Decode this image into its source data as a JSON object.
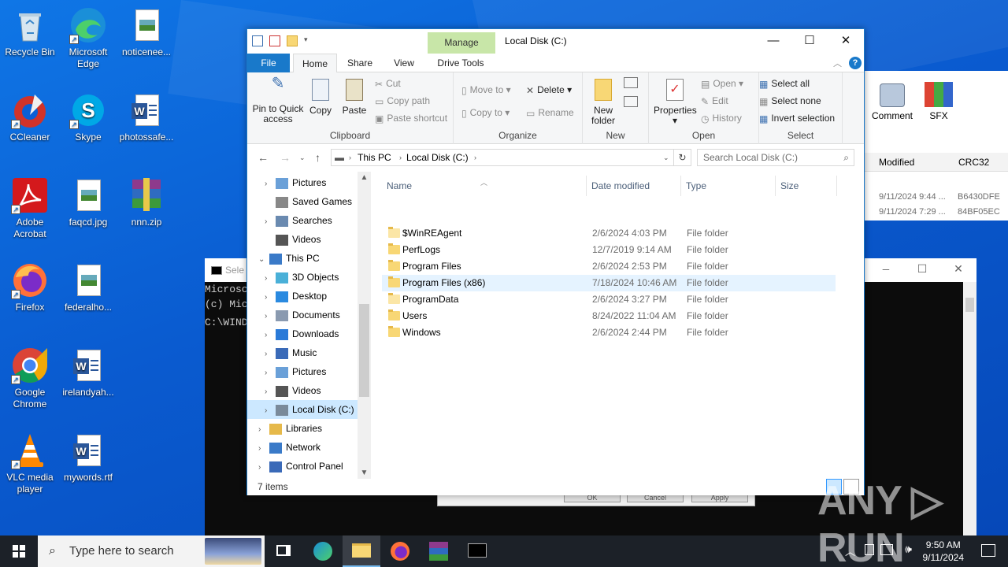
{
  "desktop": {
    "icons": [
      {
        "label": "Recycle Bin"
      },
      {
        "label": "Microsoft Edge"
      },
      {
        "label": "noticenee..."
      },
      {
        "label": "CCleaner"
      },
      {
        "label": "Skype"
      },
      {
        "label": "photossafe..."
      },
      {
        "label": "Adobe Acrobat"
      },
      {
        "label": "faqcd.jpg"
      },
      {
        "label": "nnn.zip"
      },
      {
        "label": "Firefox"
      },
      {
        "label": "federalho..."
      },
      {
        "label": "Google Chrome"
      },
      {
        "label": "irelandyah..."
      },
      {
        "label": "VLC media player"
      },
      {
        "label": "mywords.rtf"
      }
    ]
  },
  "console": {
    "title": "Sele",
    "lines": [
      "Microsc",
      "(c) Mic",
      "",
      "C:\\WIND"
    ],
    "controls": {
      "min": "—",
      "max": "☐",
      "close": "✕"
    }
  },
  "dialog": {
    "buttons": [
      "OK",
      "Cancel",
      "Apply"
    ]
  },
  "winrar": {
    "tools": [
      {
        "label": "Comment"
      },
      {
        "label": "SFX"
      }
    ],
    "columns": [
      "Modified",
      "CRC32"
    ],
    "rows": [
      {
        "modified": "9/11/2024 9:44 ...",
        "crc": "B6430DFE"
      },
      {
        "modified": "9/11/2024 7:29 ...",
        "crc": "84BF05EC"
      }
    ]
  },
  "explorer": {
    "title": "Local Disk (C:)",
    "context_tab": "Manage",
    "controls": {
      "min": "—",
      "max": "☐",
      "close": "✕"
    },
    "tabs": [
      "File",
      "Home",
      "Share",
      "View",
      "Drive Tools"
    ],
    "ribbon": {
      "clipboard": {
        "label": "Clipboard",
        "pin": "Pin to Quick access",
        "copy": "Copy",
        "paste": "Paste",
        "cut": "Cut",
        "copy_path": "Copy path",
        "paste_shortcut": "Paste shortcut"
      },
      "organize": {
        "label": "Organize",
        "move_to": "Move to",
        "copy_to": "Copy to",
        "delete": "Delete",
        "rename": "Rename"
      },
      "new": {
        "label": "New",
        "new_folder": "New folder"
      },
      "open": {
        "label": "Open",
        "properties": "Properties",
        "open": "Open",
        "edit": "Edit",
        "history": "History"
      },
      "select": {
        "label": "Select",
        "select_all": "Select all",
        "select_none": "Select none",
        "invert": "Invert selection"
      }
    },
    "address": {
      "crumbs": [
        "This PC",
        "Local Disk (C:)"
      ],
      "search_placeholder": "Search Local Disk (C:)"
    },
    "tree": [
      {
        "label": "Pictures",
        "indent": 2,
        "chev": "›"
      },
      {
        "label": "Saved Games",
        "indent": 2,
        "chev": ""
      },
      {
        "label": "Searches",
        "indent": 2,
        "chev": "›"
      },
      {
        "label": "Videos",
        "indent": 2,
        "chev": ""
      },
      {
        "label": "This PC",
        "indent": 1,
        "chev": "⌄"
      },
      {
        "label": "3D Objects",
        "indent": 2,
        "chev": "›"
      },
      {
        "label": "Desktop",
        "indent": 2,
        "chev": "›"
      },
      {
        "label": "Documents",
        "indent": 2,
        "chev": "›"
      },
      {
        "label": "Downloads",
        "indent": 2,
        "chev": "›"
      },
      {
        "label": "Music",
        "indent": 2,
        "chev": "›"
      },
      {
        "label": "Pictures",
        "indent": 2,
        "chev": "›"
      },
      {
        "label": "Videos",
        "indent": 2,
        "chev": "›"
      },
      {
        "label": "Local Disk (C:)",
        "indent": 2,
        "chev": "›",
        "selected": true
      },
      {
        "label": "Libraries",
        "indent": 1,
        "chev": "›"
      },
      {
        "label": "Network",
        "indent": 1,
        "chev": "›"
      },
      {
        "label": "Control Panel",
        "indent": 1,
        "chev": "›"
      }
    ],
    "columns": [
      "Name",
      "Date modified",
      "Type",
      "Size"
    ],
    "files": [
      {
        "name": "$WinREAgent",
        "date": "2/6/2024 4:03 PM",
        "type": "File folder",
        "light": true
      },
      {
        "name": "PerfLogs",
        "date": "12/7/2019 9:14 AM",
        "type": "File folder"
      },
      {
        "name": "Program Files",
        "date": "2/6/2024 2:53 PM",
        "type": "File folder"
      },
      {
        "name": "Program Files (x86)",
        "date": "7/18/2024 10:46 AM",
        "type": "File folder",
        "hover": true
      },
      {
        "name": "ProgramData",
        "date": "2/6/2024 3:27 PM",
        "type": "File folder",
        "light": true
      },
      {
        "name": "Users",
        "date": "8/24/2022 11:04 AM",
        "type": "File folder"
      },
      {
        "name": "Windows",
        "date": "2/6/2024 2:44 PM",
        "type": "File folder"
      }
    ],
    "status": "7 items"
  },
  "taskbar": {
    "search_placeholder": "Type here to search",
    "time": "9:50 AM",
    "date": "9/11/2024"
  },
  "watermark": "ANY ▷ RUN",
  "colors": {
    "accent": "#1979ca",
    "folder": "#f8d775",
    "taskbar": "#1c2128"
  }
}
